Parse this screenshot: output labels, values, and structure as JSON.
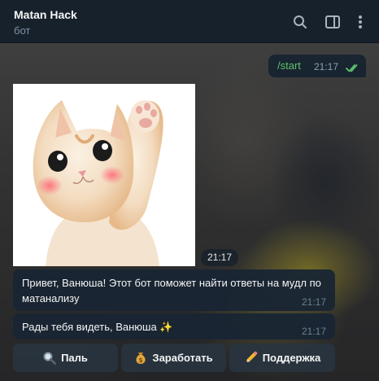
{
  "header": {
    "title": "Matan Hack",
    "subtitle": "бот",
    "icons": [
      "search-icon",
      "sidebar-toggle-icon",
      "more-vertical-icon"
    ]
  },
  "messages": {
    "outgoing": {
      "text": "/start",
      "time": "21:17",
      "status": "read"
    },
    "photo": {
      "time": "21:17",
      "subject": "kitten-waving"
    },
    "greeting": {
      "text": "Привет, Ванюша! Этот бот поможет найти ответы на мудл по матанализу",
      "time": "21:17"
    },
    "welcome": {
      "text": "Рады тебя видеть, Ванюша ✨",
      "time": "21:17"
    }
  },
  "keyboard": [
    {
      "label": "Паль",
      "icon": "magnifier-icon"
    },
    {
      "label": "Заработать",
      "icon": "money-bag-icon"
    },
    {
      "label": "Поддержка",
      "icon": "pencil-icon"
    }
  ],
  "colors": {
    "header_bg": "#17212b",
    "bubble_bg": "#182533",
    "command_green": "#5ec16b",
    "read_check": "#5ec16b"
  }
}
